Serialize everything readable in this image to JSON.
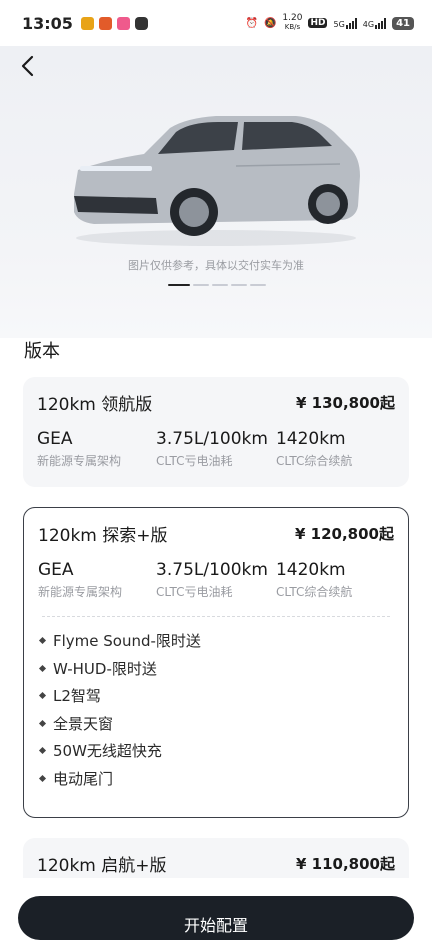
{
  "status_bar": {
    "time": "13:05",
    "net_speed_value": "1.20",
    "net_speed_unit": "KB/s",
    "hd_label": "HD",
    "sig1_label": "5G",
    "sig2_label": "4G",
    "battery": "41"
  },
  "hero": {
    "disclaimer": "图片仅供参考，具体以交付实车为准",
    "car_color": "#b7bcc3"
  },
  "section_title": "版本",
  "versions": [
    {
      "name": "120km 领航版",
      "price": "¥ 130,800起",
      "specs": [
        {
          "value": "GEA",
          "label": "新能源专属架构"
        },
        {
          "value": "3.75L/100km",
          "label": "CLTC亏电油耗"
        },
        {
          "value": "1420km",
          "label": "CLTC综合续航"
        }
      ]
    },
    {
      "name": "120km 探索+版",
      "price": "¥ 120,800起",
      "specs": [
        {
          "value": "GEA",
          "label": "新能源专属架构"
        },
        {
          "value": "3.75L/100km",
          "label": "CLTC亏电油耗"
        },
        {
          "value": "1420km",
          "label": "CLTC综合续航"
        }
      ],
      "features": [
        "Flyme Sound-限时送",
        "W-HUD-限时送",
        "L2智驾",
        "全景天窗",
        "50W无线超快充",
        "电动尾门"
      ]
    },
    {
      "name": "120km 启航+版",
      "price": "¥ 110,800起"
    }
  ],
  "cta_label": "开始配置"
}
